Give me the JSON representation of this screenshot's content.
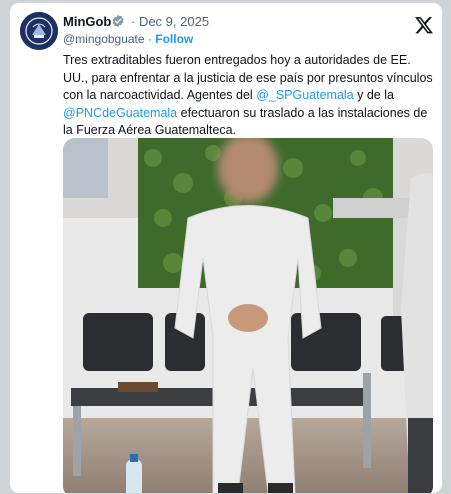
{
  "tweet": {
    "display_name": "MinGob",
    "date": "· Dec 9, 2025",
    "handle": "@mingobguate",
    "separator": " · ",
    "follow_label": "Follow",
    "text_part1": "Tres extraditables fueron entregados hoy a autoridades de EE. UU., para enfrentar a la justicia de ese país por presuntos vínculos con la narcoactividad. Agentes del ",
    "mention1": "@_SPGuatemala",
    "text_part2": " y de la ",
    "mention2": "@PNCdeGuatemala",
    "text_part3": " efectuaron su traslado a las instalaciones de la Fuerza Aérea Guatemalteca."
  },
  "icons": {
    "avatar": "guatemala-coat-of-arms-icon",
    "verified": "verified-badge-icon",
    "platform": "x-logo-icon"
  },
  "colors": {
    "link": "#1d9bf0",
    "text": "#0f1419",
    "muted": "#536471",
    "avatar_bg": "#1d2f63"
  }
}
